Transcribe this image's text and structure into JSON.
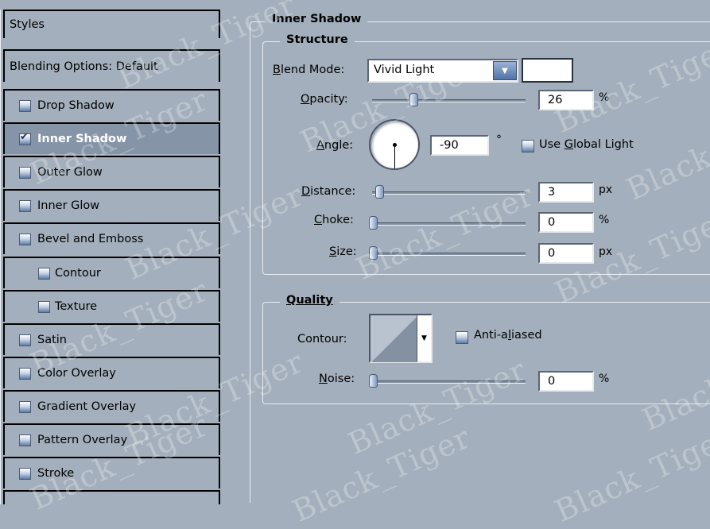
{
  "styles_list": {
    "header": "Styles",
    "blending": "Blending Options: Default",
    "items": [
      {
        "label": "Drop Shadow",
        "checked": false,
        "indent": false
      },
      {
        "label": "Inner Shadow",
        "checked": true,
        "indent": false,
        "selected": true
      },
      {
        "label": "Outer Glow",
        "checked": false,
        "indent": false
      },
      {
        "label": "Inner Glow",
        "checked": false,
        "indent": false
      },
      {
        "label": "Bevel and Emboss",
        "checked": false,
        "indent": false
      },
      {
        "label": "Contour",
        "checked": false,
        "indent": true
      },
      {
        "label": "Texture",
        "checked": false,
        "indent": true
      },
      {
        "label": "Satin",
        "checked": false,
        "indent": false
      },
      {
        "label": "Color Overlay",
        "checked": false,
        "indent": false
      },
      {
        "label": "Gradient Overlay",
        "checked": false,
        "indent": false
      },
      {
        "label": "Pattern Overlay",
        "checked": false,
        "indent": false
      },
      {
        "label": "Stroke",
        "checked": false,
        "indent": false
      }
    ]
  },
  "panel": {
    "title": "Inner Shadow",
    "structure": {
      "legend": "Structure",
      "blend_mode": {
        "label_u": "B",
        "label_rest": "lend Mode:",
        "value": "Vivid Light",
        "color": "#ffffff"
      },
      "opacity": {
        "label_u": "O",
        "label_rest": "pacity:",
        "value": "26",
        "unit": "%",
        "level": 26
      },
      "angle": {
        "label_u": "A",
        "label_rest": "ngle:",
        "value": "-90",
        "unit": "°",
        "degrees": -90
      },
      "global_light": {
        "pre": "Use ",
        "u": "G",
        "post": "lobal Light",
        "checked": false
      },
      "distance": {
        "label_u": "D",
        "label_rest": "istance:",
        "value": "3",
        "unit": "px"
      },
      "choke": {
        "label_u": "C",
        "label_rest": "hoke:",
        "value": "0",
        "unit": "%"
      },
      "size": {
        "label_u": "S",
        "label_rest": "ize:",
        "value": "0",
        "unit": "px"
      }
    },
    "quality": {
      "legend": "Quality",
      "contour_label": "Contour:",
      "anti_aliased": {
        "pre": "Anti-a",
        "u": "l",
        "post": "iased",
        "checked": false
      },
      "noise": {
        "label_u": "N",
        "label_rest": "oise:",
        "value": "0",
        "unit": "%"
      }
    }
  },
  "watermark": "Black_Tiger"
}
